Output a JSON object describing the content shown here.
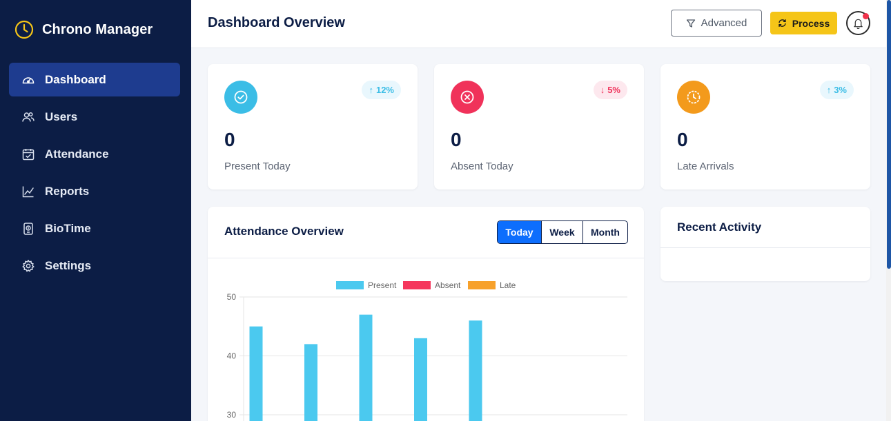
{
  "app": {
    "name": "Chrono Manager"
  },
  "sidebar": {
    "items": [
      {
        "label": "Dashboard",
        "icon": "speedometer-icon",
        "active": true
      },
      {
        "label": "Users",
        "icon": "users-icon"
      },
      {
        "label": "Attendance",
        "icon": "calendar-check-icon"
      },
      {
        "label": "Reports",
        "icon": "line-chart-icon"
      },
      {
        "label": "BioTime",
        "icon": "fingerprint-device-icon"
      },
      {
        "label": "Settings",
        "icon": "gear-icon"
      }
    ]
  },
  "header": {
    "title": "Dashboard Overview",
    "advanced_label": "Advanced",
    "process_label": "Process"
  },
  "stats": [
    {
      "value": "0",
      "label": "Present Today",
      "trend": "12%",
      "trend_dir": "up",
      "color": "#3bbde6"
    },
    {
      "value": "0",
      "label": "Absent Today",
      "trend": "5%",
      "trend_dir": "down",
      "color": "#f0325a"
    },
    {
      "value": "0",
      "label": "Late Arrivals",
      "trend": "3%",
      "trend_dir": "up",
      "color": "#f39a1c"
    }
  ],
  "attendance": {
    "title": "Attendance Overview",
    "ranges": [
      "Today",
      "Week",
      "Month"
    ],
    "selected_range": "Today"
  },
  "recent": {
    "title": "Recent Activity"
  },
  "colors": {
    "sidebar_bg": "#0c1d45",
    "active_nav": "#1e3c8f",
    "accent": "#0d6efd",
    "process": "#f5c518"
  },
  "chart_data": {
    "type": "bar",
    "categories": [
      "",
      "",
      "",
      "",
      ""
    ],
    "series": [
      {
        "name": "Present",
        "values": [
          45,
          42,
          47,
          43,
          46
        ],
        "color": "#4bc9ef"
      },
      {
        "name": "Absent",
        "values": [],
        "color": "#f5365c"
      },
      {
        "name": "Late",
        "values": [],
        "color": "#f7a12b"
      }
    ],
    "ylim": [
      30,
      50
    ],
    "yticks": [
      50,
      40,
      30
    ],
    "grid": true,
    "legend": "top-center"
  }
}
